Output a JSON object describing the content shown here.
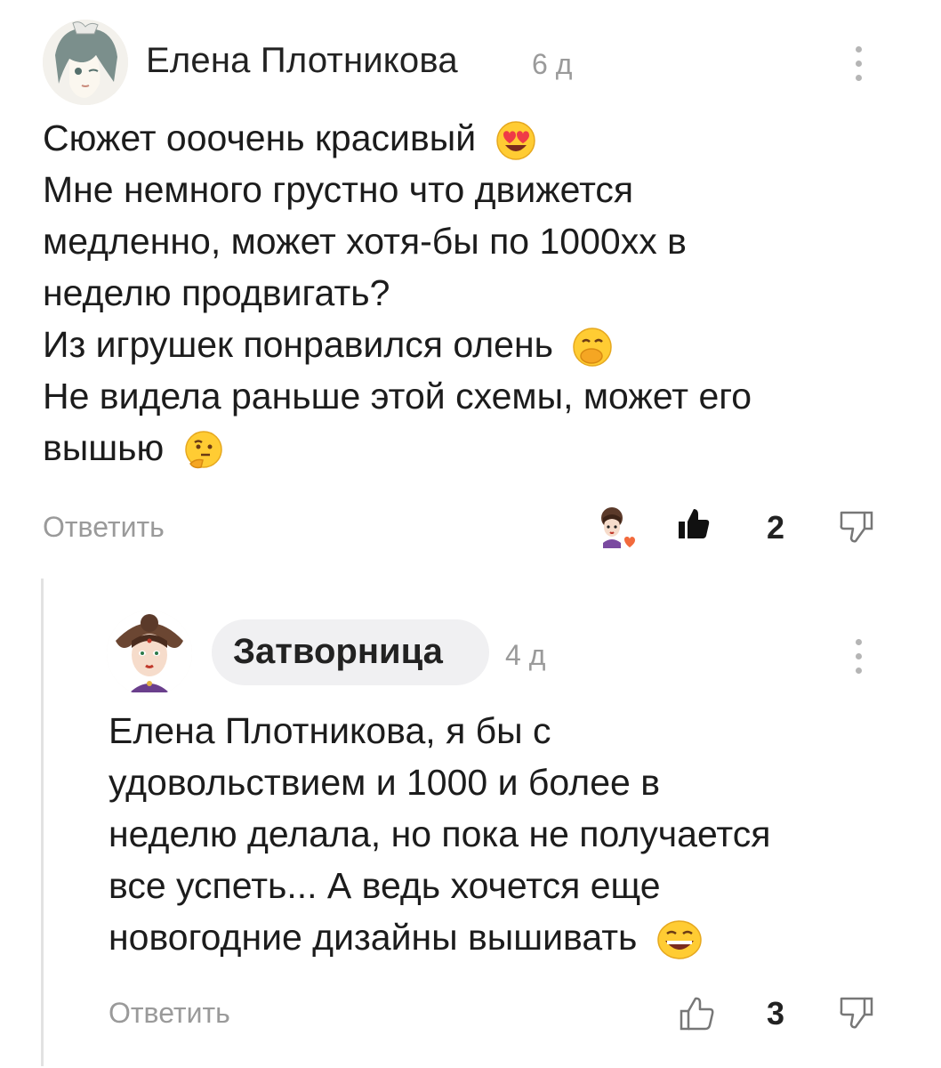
{
  "comment1": {
    "author": "Елена Плотникова",
    "time": "6 д",
    "lines": [
      "Сюжет ооочень красивый",
      "Мне немного грустно что движется",
      "медленно, может хотя-бы по 1000хх в",
      "неделю продвигать?",
      "Из игрушек понравился олень",
      "Не видела раньше этой схемы, может его",
      "вышью"
    ],
    "emoji_icons": [
      "heart-eyes-emoji",
      "hand-over-mouth-emoji",
      "thinking-emoji"
    ],
    "reply_label": "Ответить",
    "likes": "2",
    "liked": true
  },
  "comment2": {
    "author": "Затворница",
    "time": "4 д",
    "lines": [
      "Елена Плотникова, я бы с",
      "удовольствием и 1000 и более в",
      "неделю делала, но пока не получается",
      "все успеть... А ведь хочется еще",
      "новогодние дизайны вышивать"
    ],
    "emoji_icons": [
      "grinning-squinting-emoji"
    ],
    "reply_label": "Ответить",
    "likes": "3",
    "liked": false
  },
  "colors": {
    "muted": "#9a9a9a",
    "chip_bg": "#f0f0f2",
    "heart": "#f26a3c",
    "emoji_yellow": "#ffcc33"
  }
}
